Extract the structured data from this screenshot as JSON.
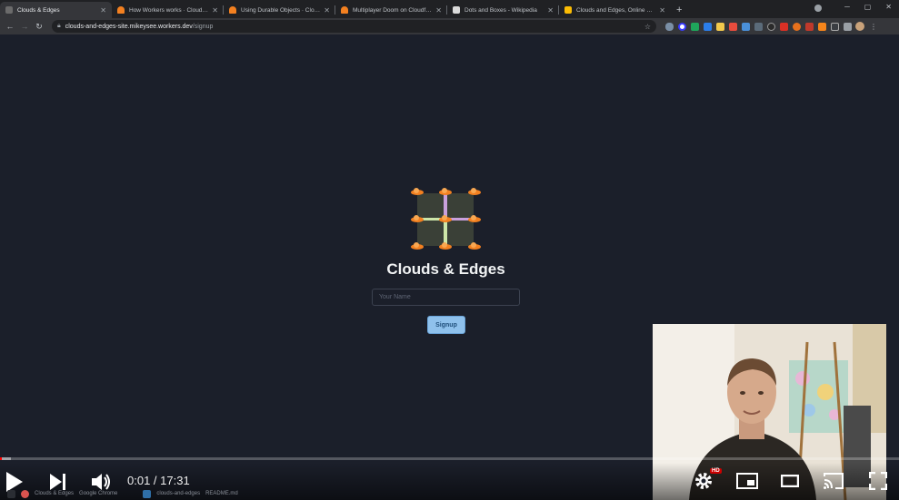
{
  "browser": {
    "tabs": [
      {
        "title": "Clouds & Edges",
        "active": true,
        "favicon_color": "#a3a3a3"
      },
      {
        "title": "How Workers works · Cloudflare",
        "active": false,
        "favicon_color": "#f38020"
      },
      {
        "title": "Using Durable Objects · Cloudflare",
        "active": false,
        "favicon_color": "#f38020"
      },
      {
        "title": "Multiplayer Doom on Cloudflare",
        "active": false,
        "favicon_color": "#f38020"
      },
      {
        "title": "Dots and Boxes - Wikipedia",
        "active": false,
        "favicon_color": "#dadada"
      },
      {
        "title": "Clouds and Edges, Online White",
        "active": false,
        "favicon_color": "#fbbc04"
      }
    ],
    "new_tab_label": "+",
    "url_host": "clouds-and-edges-site.mikeysee.workers.dev",
    "url_path": "/signup"
  },
  "page": {
    "title": "Clouds & Edges",
    "name_input_placeholder": "Your Name",
    "signup_label": "Signup"
  },
  "player": {
    "time_display": "0:01 / 17:31",
    "progress_fraction": 0.001,
    "hd_badge": "HD"
  },
  "taskbar": {
    "items": [
      "Clouds & Edges",
      "Google Chrome",
      "clouds-and-edges",
      "README.md"
    ]
  },
  "colors": {
    "page_background": "#1b1f2a",
    "accent_button": "#8fc1ec",
    "cloud_orange": "#f38020",
    "player_red": "#ff0000"
  }
}
